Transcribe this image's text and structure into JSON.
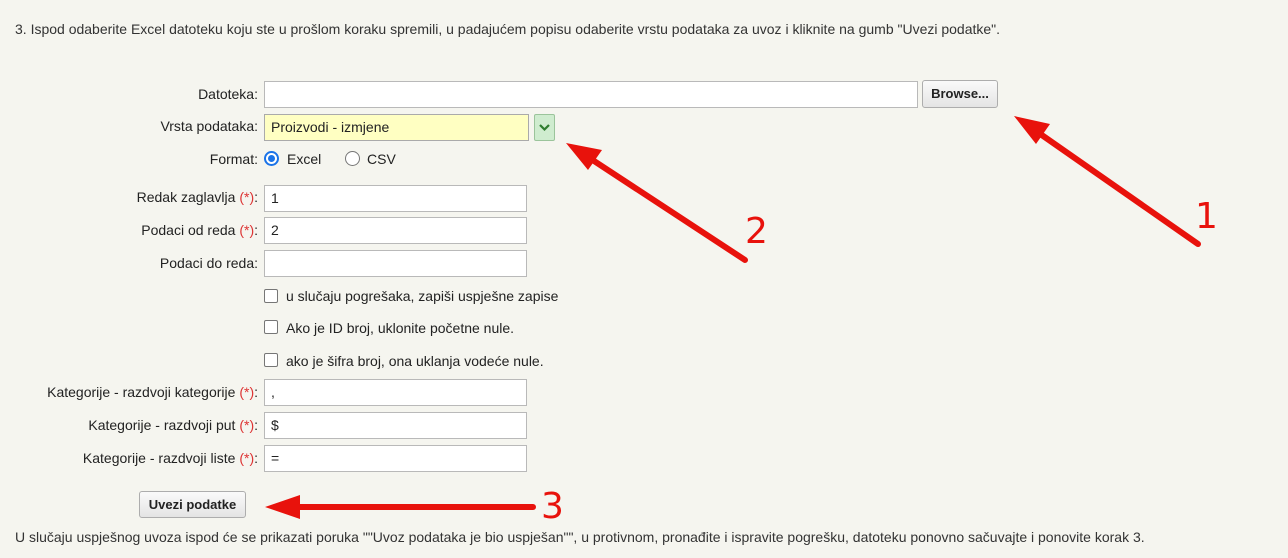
{
  "instructions": {
    "step3": "3. Ispod odaberite Excel datoteku koju ste u prošlom koraku spremili, u padajućem popisu odaberite vrstu podataka za uvoz i kliknite na gumb \"Uvezi podatke\".",
    "footer": "U slučaju uspješnog uvoza ispod će se prikazati poruka \"\"Uvoz podataka je bio uspješan\"\", u protivnom, pronađite i ispravite pogrešku, datoteku ponovno sačuvajte i ponovite korak 3."
  },
  "form": {
    "file_label": "Datoteka:",
    "file_value": "",
    "browse_label": "Browse...",
    "data_type_label": "Vrsta podataka:",
    "data_type_value": "Proizvodi - izmjene",
    "format_label": "Format:",
    "format_excel": "Excel",
    "format_csv": "CSV",
    "header_row_label": "Redak zaglavlja",
    "header_row_value": "1",
    "data_from_label": "Podaci od reda",
    "data_from_value": "2",
    "data_to_label": "Podaci do reda:",
    "data_to_value": "",
    "required_mark": "(*)",
    "colon": ":",
    "checkbox_1": "u slučaju pogrešaka, zapiši uspješne zapise",
    "checkbox_2": "Ako je ID broj, uklonite početne nule.",
    "checkbox_3": "ako je šifra broj, ona uklanja vodeće nule.",
    "cat_split_label": "Kategorije - razdvoji kategorije",
    "cat_split_value": ",",
    "cat_path_label": "Kategorije - razdvoji put",
    "cat_path_value": "$",
    "cat_list_label": "Kategorije - razdvoji liste",
    "cat_list_value": "=",
    "submit_label": "Uvezi podatke"
  },
  "annotations": {
    "n1": "1",
    "n2": "2",
    "n3": "3",
    "color": "#e8120c"
  },
  "colors": {
    "select_bg": "#ffffc2",
    "radio_accent": "#1a73e8"
  }
}
